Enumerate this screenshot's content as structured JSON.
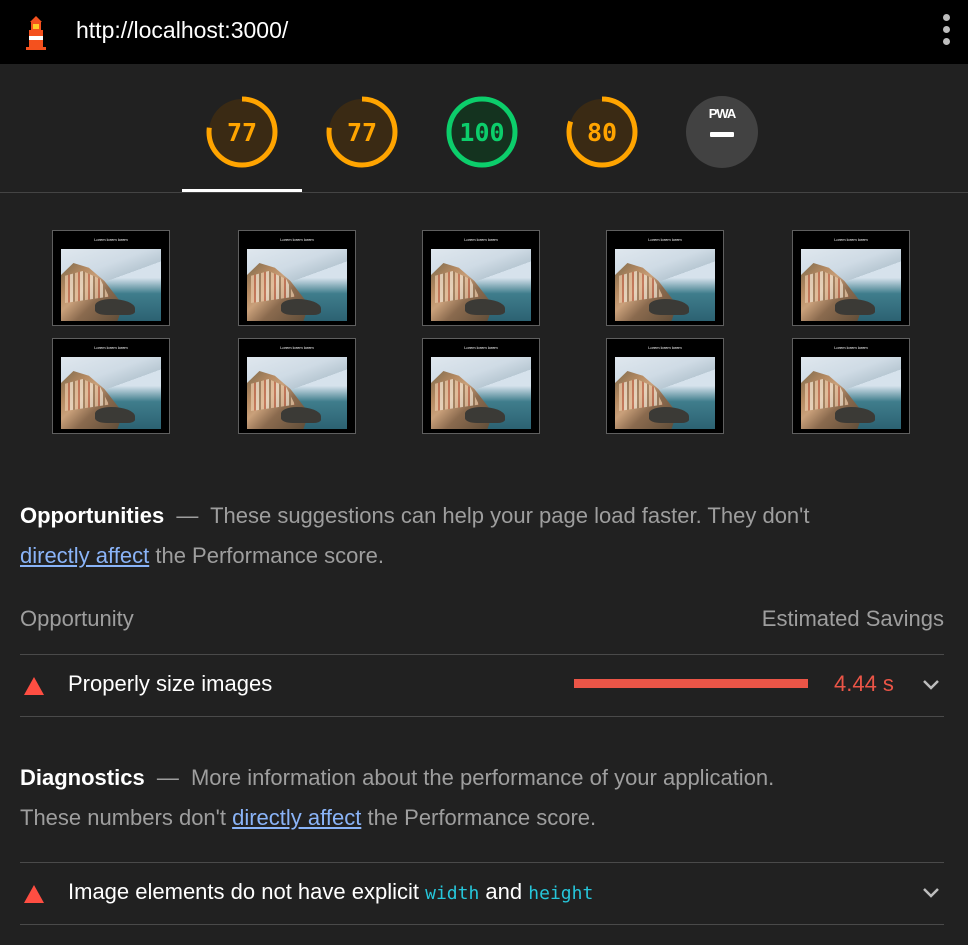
{
  "topbar": {
    "url": "http://localhost:3000/",
    "logo_icon": "lighthouse-icon",
    "menu_icon": "more-vert-icon"
  },
  "gauges": [
    {
      "name": "gauge-performance",
      "score": "77",
      "fraction": 0.77,
      "color": "#ffa400",
      "selected": true
    },
    {
      "name": "gauge-accessibility",
      "score": "77",
      "fraction": 0.77,
      "color": "#ffa400"
    },
    {
      "name": "gauge-best-practices",
      "score": "100",
      "fraction": 1.0,
      "color": "#0cce6b"
    },
    {
      "name": "gauge-seo",
      "score": "80",
      "fraction": 0.8,
      "color": "#ffa400"
    },
    {
      "name": "gauge-pwa",
      "label": "PWA",
      "color": "#9e9e9e"
    }
  ],
  "filmstrip": {
    "frame_count": 10,
    "frame_title": "Lorem lorem lorem"
  },
  "opportunities": {
    "title": "Opportunities",
    "dash": "—",
    "description": "These suggestions can help your page load faster. They don't",
    "link": "directly affect",
    "description_end": "the Performance score.",
    "col_opportunity": "Opportunity",
    "col_savings": "Estimated Savings",
    "items": [
      {
        "label": "Properly size images",
        "savings": "4.44 s",
        "bar_fraction": 1.0
      }
    ]
  },
  "diagnostics": {
    "title": "Diagnostics",
    "dash": "—",
    "description": "More information about the performance of your application.",
    "description2": "These numbers don't",
    "link": "directly affect",
    "description_end": "the Performance score.",
    "items": [
      {
        "label_pre": "Image elements do not have explicit",
        "code1": "width",
        "label_mid": "and",
        "code2": "height"
      }
    ]
  },
  "colors": {
    "fail": "#eb5547",
    "average": "#ffa400",
    "pass": "#0cce6b",
    "link": "#8ab4f8"
  }
}
